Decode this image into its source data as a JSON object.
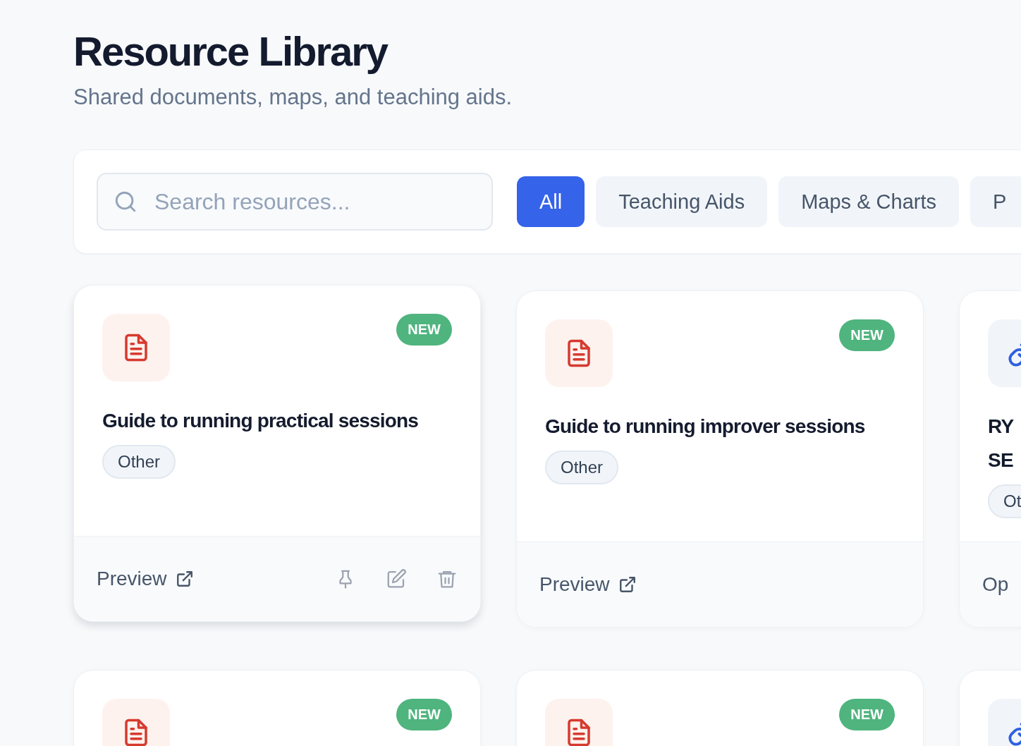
{
  "header": {
    "title": "Resource Library",
    "subtitle": "Shared documents, maps, and teaching aids."
  },
  "search": {
    "placeholder": "Search resources..."
  },
  "filters": [
    {
      "label": "All",
      "selected": true
    },
    {
      "label": "Teaching Aids",
      "selected": false
    },
    {
      "label": "Maps & Charts",
      "selected": false
    },
    {
      "label": "P",
      "selected": false
    }
  ],
  "cards": [
    {
      "kind": "document",
      "badge": "NEW",
      "title_lines": [
        "Guide to running practical sessions"
      ],
      "tag": "Other",
      "link": "Preview",
      "link_external": true,
      "hovered": true
    },
    {
      "kind": "document",
      "badge": "NEW",
      "title_lines": [
        "Guide to running improver sessions"
      ],
      "tag": "Other",
      "link": "Preview",
      "link_external": true,
      "hovered": false
    },
    {
      "kind": "link",
      "title_lines": [
        "RY",
        "SE"
      ],
      "tag": "Ot",
      "link": "Op",
      "link_external": false,
      "hovered": false
    },
    {
      "kind": "document",
      "badge": "NEW",
      "hovered": false
    },
    {
      "kind": "document",
      "badge": "NEW",
      "hovered": false
    },
    {
      "kind": "link",
      "hovered": false
    }
  ]
}
